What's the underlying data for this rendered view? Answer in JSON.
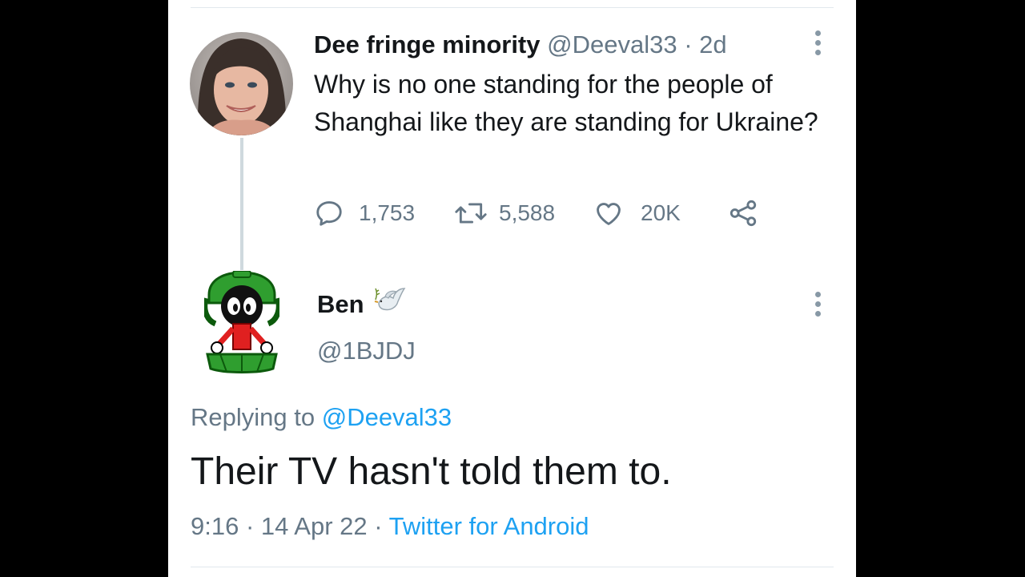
{
  "tweet": {
    "author_name": "Dee fringe minority",
    "author_handle": "@Deeval33",
    "separator": "·",
    "time_ago": "2d",
    "text": "Why is no one standing for the people of Shanghai like they are standing for Ukraine?",
    "stats": {
      "replies": "1,753",
      "retweets": "5,588",
      "likes": "20K"
    }
  },
  "reply": {
    "author_name": "Ben",
    "name_emoji": "dove-of-peace-icon",
    "author_handle": "@1BJDJ",
    "replying_prefix": "Replying to",
    "replying_handle": "@Deeval33",
    "text": "Their TV hasn't told them to.",
    "time": "9:16",
    "date": "14 Apr 22",
    "separator": "·",
    "client": "Twitter for Android"
  },
  "colors": {
    "text": "#14171a",
    "muted": "#657786",
    "link": "#1da1f2",
    "divider": "#e1e8ed"
  }
}
